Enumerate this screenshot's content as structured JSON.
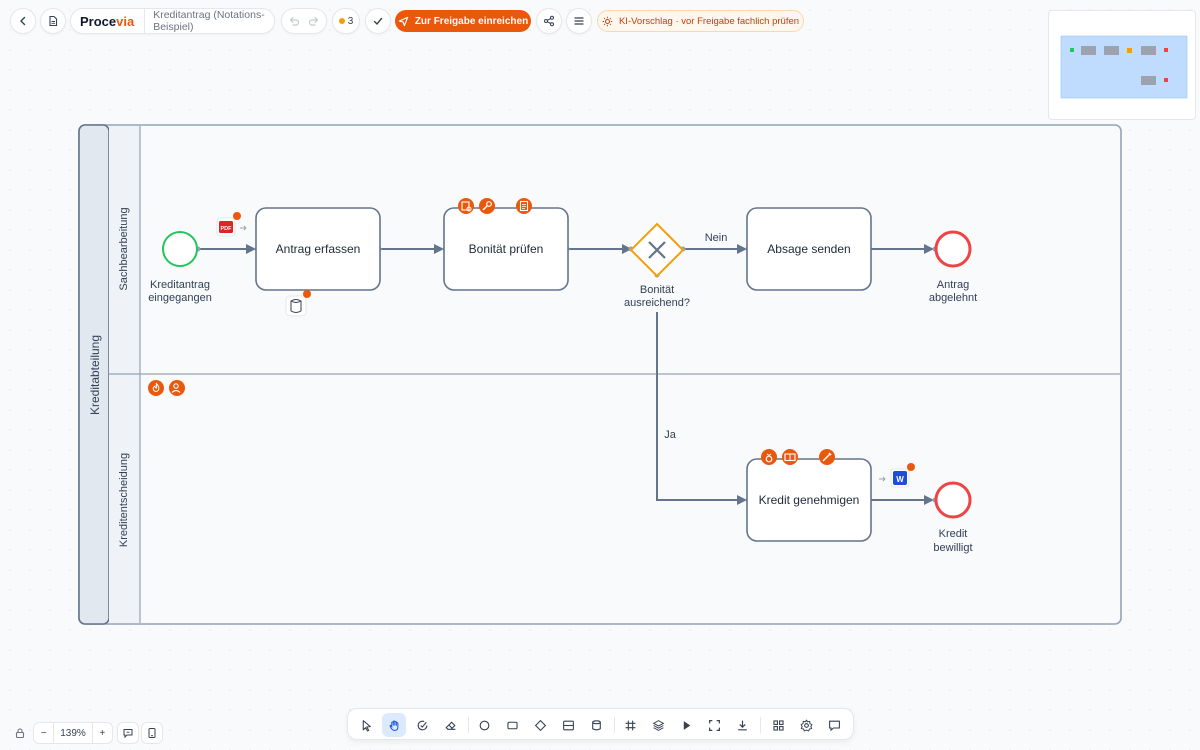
{
  "app": {
    "brand_main": "Proce",
    "brand_accent": "via",
    "document_title": "Kreditantrag (Notations-Beispiel)"
  },
  "toolbar": {
    "comment_count": "3",
    "submit_label": "Zur Freigabe einreichen",
    "ai_label": "KI-Vorschlag · vor Freigabe fachlich prüfen"
  },
  "colors": {
    "accent": "#ea580c",
    "start_event": "#22c55e",
    "end_event": "#ef4444",
    "gateway": "#f59e0b",
    "flow": "#64748b"
  },
  "pool": {
    "name": "Kreditabteilung",
    "lanes": [
      {
        "name": "Sachbearbeitung"
      },
      {
        "name": "Kreditentscheidung"
      }
    ]
  },
  "nodes": {
    "start": {
      "label_line1": "Kreditantrag",
      "label_line2": "eingegangen"
    },
    "task_antrag": {
      "label": "Antrag erfassen"
    },
    "task_bonitaet": {
      "label": "Bonität prüfen"
    },
    "gateway": {
      "label_line1": "Bonität",
      "label_line2": "ausreichend?"
    },
    "task_absage": {
      "label": "Absage senden"
    },
    "end_abgelehnt": {
      "label_line1": "Antrag",
      "label_line2": "abgelehnt"
    },
    "task_kredit": {
      "label": "Kredit genehmigen"
    },
    "end_bewilligt": {
      "label_line1": "Kredit",
      "label_line2": "bewilligt"
    }
  },
  "flows": {
    "nein_label": "Nein",
    "ja_label": "Ja"
  },
  "badges": {
    "pdf": "PDF",
    "word": "W"
  },
  "zoom": {
    "level": "139%",
    "minus": "−",
    "plus": "+"
  }
}
